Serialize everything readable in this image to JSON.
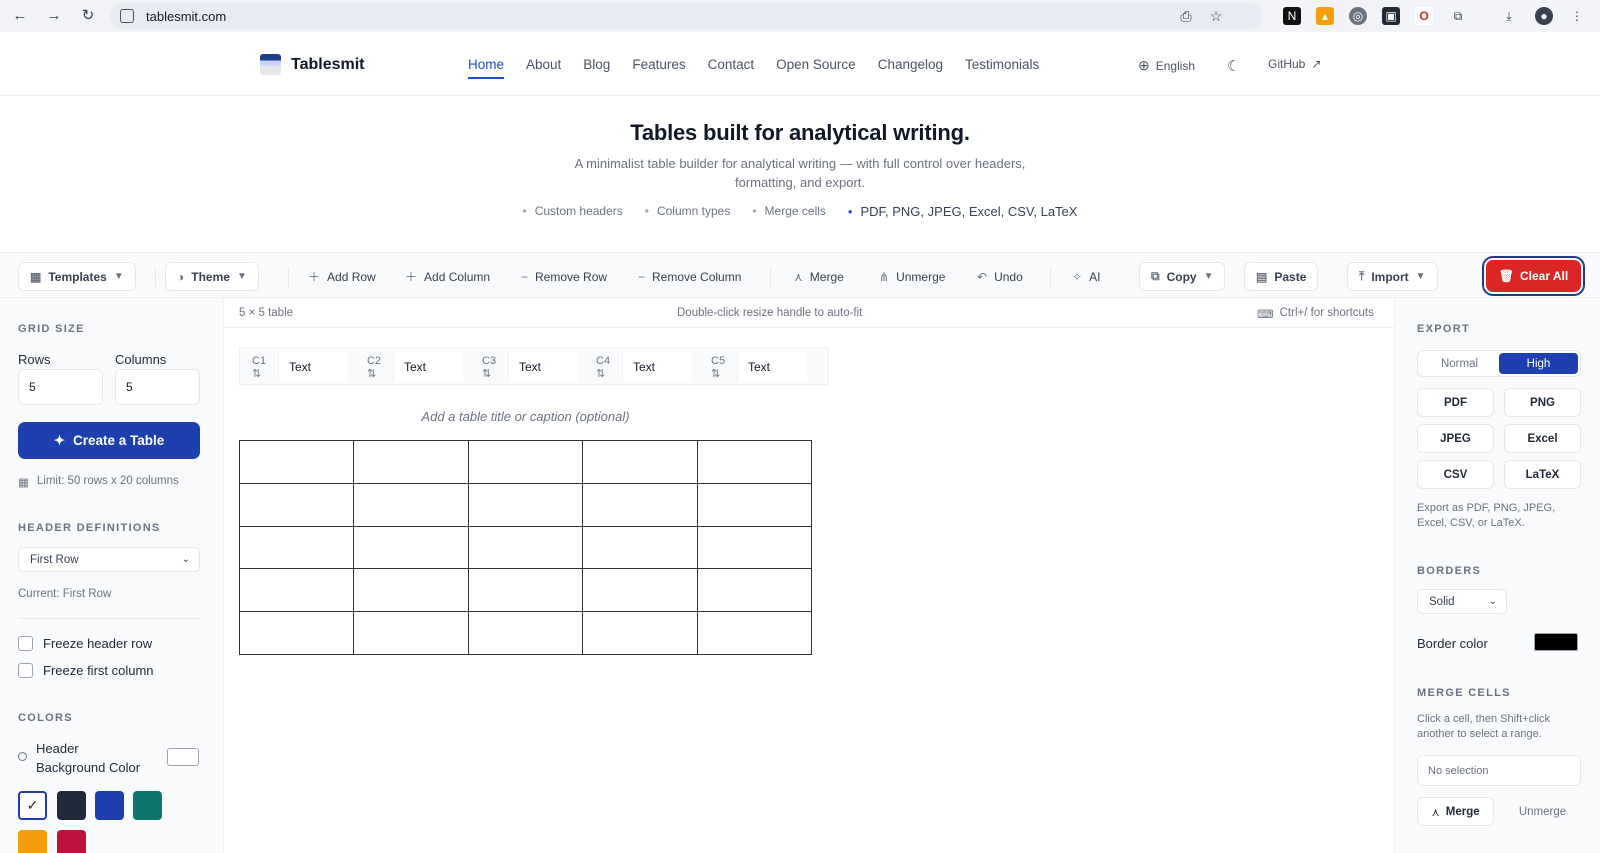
{
  "browser": {
    "url": "tablesmit.com",
    "nav_icons": [
      "back-icon",
      "forward-icon",
      "reload-icon"
    ]
  },
  "site": {
    "brand": "Tablesmit",
    "nav": [
      "Home",
      "About",
      "Blog",
      "Features",
      "Contact",
      "Open Source",
      "Changelog",
      "Testimonials"
    ],
    "active_nav": "Home",
    "language": "English",
    "github": "GitHub"
  },
  "hero": {
    "title": "Tables built for analytical writing.",
    "subtitle": "A minimalist table builder for analytical writing — with full control over headers, formatting, and export.",
    "bullets": [
      "Custom headers",
      "Column types",
      "Merge cells",
      "PDF, PNG, JPEG, Excel, CSV, LaTeX"
    ]
  },
  "toolbar": {
    "templates": "Templates",
    "theme": "Theme",
    "add_row": "Add Row",
    "add_column": "Add Column",
    "remove_row": "Remove Row",
    "remove_column": "Remove Column",
    "merge": "Merge",
    "unmerge": "Unmerge",
    "undo": "Undo",
    "ai": "AI",
    "copy": "Copy",
    "paste": "Paste",
    "import": "Import",
    "clear_all": "Clear All"
  },
  "left": {
    "grid_size_title": "GRID SIZE",
    "rows_label": "Rows",
    "rows_value": "5",
    "columns_label": "Columns",
    "columns_value": "5",
    "create_button": "Create a Table",
    "limit": "Limit: 50 rows x 20 columns",
    "header_defs_title": "HEADER DEFINITIONS",
    "header_select": "First Row",
    "current": "Current: First Row",
    "freeze_header": "Freeze header row",
    "freeze_first_col": "Freeze first column",
    "colors_title": "COLORS",
    "header_bg_line1": "Header",
    "header_bg_line2": "Background Color",
    "swatches": [
      "#ffffff",
      "#1f2937",
      "#1e3fae",
      "#0f766e",
      "#f59e0b",
      "#be123c"
    ]
  },
  "center": {
    "table_size": "5 × 5 table",
    "hint": "Double-click resize handle to auto-fit",
    "shortcut": "Ctrl+/ for shortcuts",
    "columns": [
      {
        "id": "C1 ⇅",
        "type": "Text"
      },
      {
        "id": "C2 ⇅",
        "type": "Text"
      },
      {
        "id": "C3 ⇅",
        "type": "Text"
      },
      {
        "id": "C4 ⇅",
        "type": "Text"
      },
      {
        "id": "C5 ⇅",
        "type": "Text"
      }
    ],
    "caption_placeholder": "Add a table title or caption (optional)"
  },
  "right": {
    "export_title": "EXPORT",
    "quality_normal": "Normal",
    "quality_high": "High",
    "formats": [
      "PDF",
      "PNG",
      "JPEG",
      "Excel",
      "CSV",
      "LaTeX"
    ],
    "export_note": "Export as PDF, PNG, JPEG, Excel, CSV, or LaTeX.",
    "borders_title": "BORDERS",
    "border_style": "Solid",
    "border_color_label": "Border color",
    "border_color": "#000000",
    "merge_title": "MERGE CELLS",
    "merge_note": "Click a cell, then Shift+click another to select a range.",
    "no_selection": "No selection",
    "merge": "Merge",
    "unmerge": "Unmerge"
  },
  "colors": {
    "accent": "#1d4ed8",
    "danger": "#dc2626"
  }
}
